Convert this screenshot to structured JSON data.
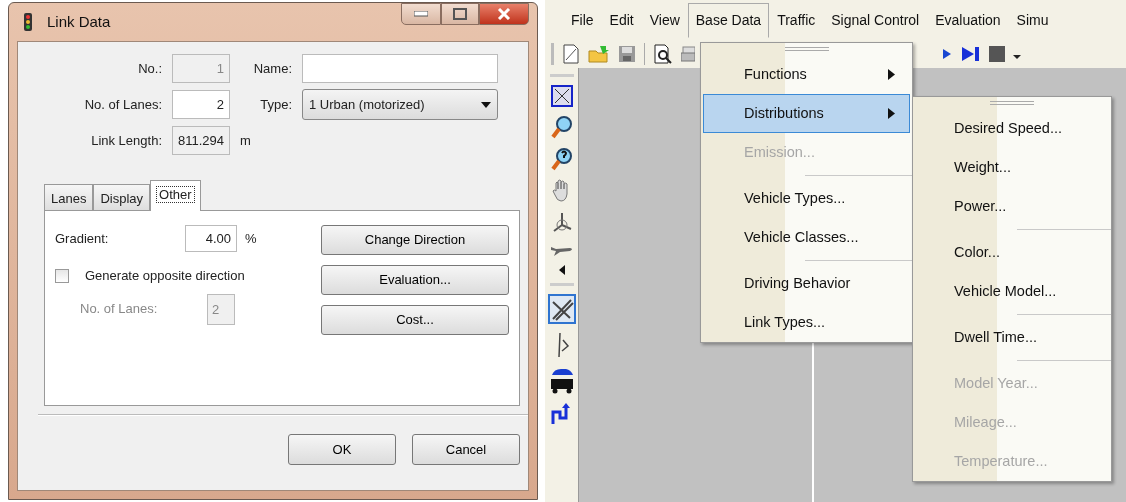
{
  "dialog": {
    "title": "Link Data",
    "fields": [
      {
        "label": "No.:",
        "value": "1",
        "disabled": true
      },
      {
        "label": "Name:",
        "disabled": false
      },
      {
        "label": "No. of Lanes:",
        "value": "2",
        "disabled": false
      },
      {
        "label": "Type:",
        "value": "1 Urban (motorized)",
        "kind": "select",
        "disabled": false
      },
      {
        "label": "Link Length:",
        "value": "811.294",
        "unit": "m",
        "disabled": true
      }
    ],
    "tabs": [
      {
        "label": "Lanes",
        "selected": false
      },
      {
        "label": "Display",
        "selected": false
      },
      {
        "label": "Other",
        "selected": true
      }
    ],
    "gradient": {
      "label": "Gradient:",
      "value": "4.00",
      "unit": "%"
    },
    "opposite": {
      "label": "Generate opposite direction",
      "checked": false
    },
    "opposite_lanes": {
      "label": "No. of Lanes:",
      "value": "2",
      "disabled": true
    },
    "side_buttons": [
      "Change Direction",
      "Evaluation...",
      "Cost..."
    ],
    "buttons": [
      "OK",
      "Cancel"
    ]
  },
  "app": {
    "menu": [
      {
        "label": "File",
        "selected": false
      },
      {
        "label": "Edit",
        "selected": false
      },
      {
        "label": "View",
        "selected": false
      },
      {
        "label": "Base Data",
        "selected": true
      },
      {
        "label": "Traffic",
        "selected": false
      },
      {
        "label": "Signal Control",
        "selected": false
      },
      {
        "label": "Evaluation",
        "selected": false
      },
      {
        "label": "Simu",
        "selected": false
      }
    ],
    "base_data_menu": [
      {
        "kind": "item",
        "label": "Functions",
        "submenu": true,
        "disabled": false,
        "selected": false
      },
      {
        "kind": "item",
        "label": "Distributions",
        "submenu": true,
        "disabled": false,
        "selected": true
      },
      {
        "kind": "item",
        "label": "Emission...",
        "submenu": false,
        "disabled": true,
        "selected": false
      },
      {
        "kind": "separator"
      },
      {
        "kind": "item",
        "label": "Vehicle Types...",
        "submenu": false,
        "disabled": false,
        "selected": false
      },
      {
        "kind": "item",
        "label": "Vehicle Classes...",
        "submenu": false,
        "disabled": false,
        "selected": false
      },
      {
        "kind": "separator"
      },
      {
        "kind": "item",
        "label": "Driving Behavior",
        "submenu": false,
        "disabled": false,
        "selected": false
      },
      {
        "kind": "item",
        "label": "Link Types...",
        "submenu": false,
        "disabled": false,
        "selected": false
      }
    ],
    "distributions_menu": [
      {
        "kind": "item",
        "label": "Desired Speed...",
        "disabled": false
      },
      {
        "kind": "item",
        "label": "Weight...",
        "disabled": false
      },
      {
        "kind": "item",
        "label": "Power...",
        "disabled": false
      },
      {
        "kind": "separator"
      },
      {
        "kind": "item",
        "label": "Color...",
        "disabled": false
      },
      {
        "kind": "item",
        "label": "Vehicle Model...",
        "disabled": false
      },
      {
        "kind": "separator"
      },
      {
        "kind": "item",
        "label": "Dwell Time...",
        "disabled": false
      },
      {
        "kind": "separator"
      },
      {
        "kind": "item",
        "label": "Model Year...",
        "disabled": true
      },
      {
        "kind": "item",
        "label": "Mileage...",
        "disabled": true
      },
      {
        "kind": "item",
        "label": "Temperature...",
        "disabled": true
      }
    ]
  }
}
